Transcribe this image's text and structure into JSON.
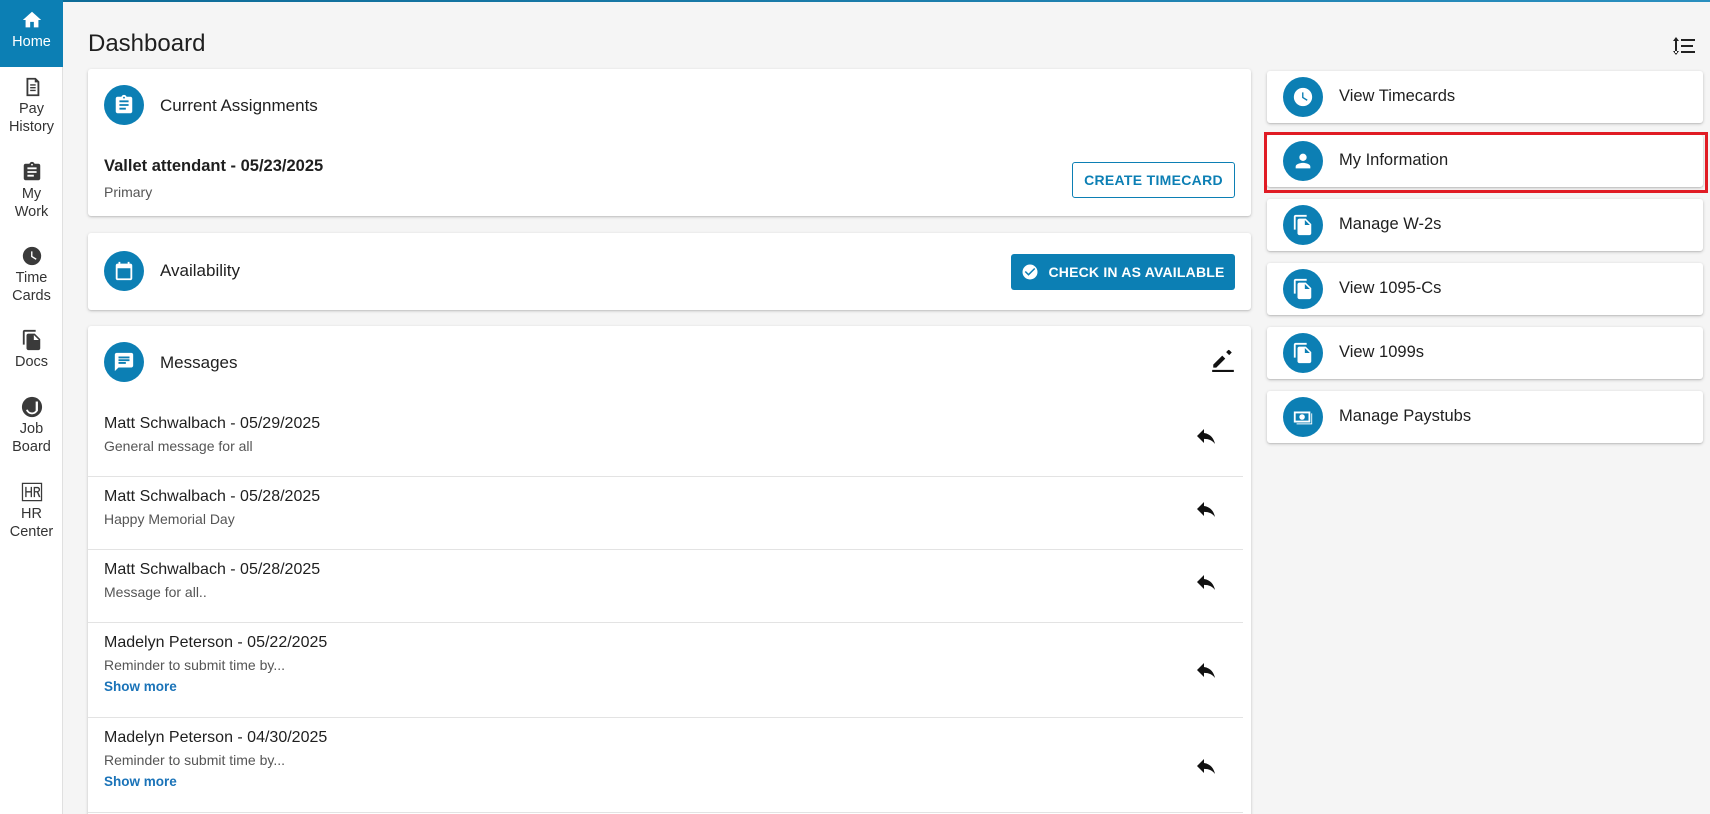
{
  "nav": [
    {
      "label": "Home",
      "icon": "home-icon"
    },
    {
      "label": "Pay\nHistory",
      "icon": "receipt-icon"
    },
    {
      "label": "My\nWork",
      "icon": "clipboard-icon"
    },
    {
      "label": "Time\nCards",
      "icon": "clock-icon"
    },
    {
      "label": "Docs",
      "icon": "documents-icon"
    },
    {
      "label": "Job\nBoard",
      "icon": "job-board-icon"
    },
    {
      "label": "HR\nCenter",
      "icon": "hr-icon"
    }
  ],
  "page": {
    "title": "Dashboard"
  },
  "assignments": {
    "title": "Current Assignments",
    "name": "Vallet attendant - 05/23/2025",
    "sub": "Primary",
    "button": "CREATE TIMECARD"
  },
  "availability": {
    "title": "Availability",
    "button": "CHECK IN AS AVAILABLE"
  },
  "messages": {
    "title": "Messages",
    "items": [
      {
        "title": "Matt Schwalbach - 05/29/2025",
        "body": "General message for all",
        "more": ""
      },
      {
        "title": "Matt Schwalbach - 05/28/2025",
        "body": "Happy Memorial Day",
        "more": ""
      },
      {
        "title": "Matt Schwalbach - 05/28/2025",
        "body": "Message for all..",
        "more": ""
      },
      {
        "title": "Madelyn Peterson - 05/22/2025",
        "body": "Reminder to submit time by...",
        "more": "Show more"
      },
      {
        "title": "Madelyn Peterson - 04/30/2025",
        "body": "Reminder to submit time by...",
        "more": "Show more"
      }
    ]
  },
  "quick_links": [
    {
      "label": "View Timecards",
      "icon": "clock-icon"
    },
    {
      "label": "My Information",
      "icon": "person-icon"
    },
    {
      "label": "Manage W-2s",
      "icon": "documents-icon"
    },
    {
      "label": "View 1095-Cs",
      "icon": "documents-icon"
    },
    {
      "label": "View 1099s",
      "icon": "documents-icon"
    },
    {
      "label": "Manage Paystubs",
      "icon": "paystub-icon"
    }
  ],
  "colors": {
    "accent": "#0c7fb4",
    "highlight": "#e01b24"
  }
}
